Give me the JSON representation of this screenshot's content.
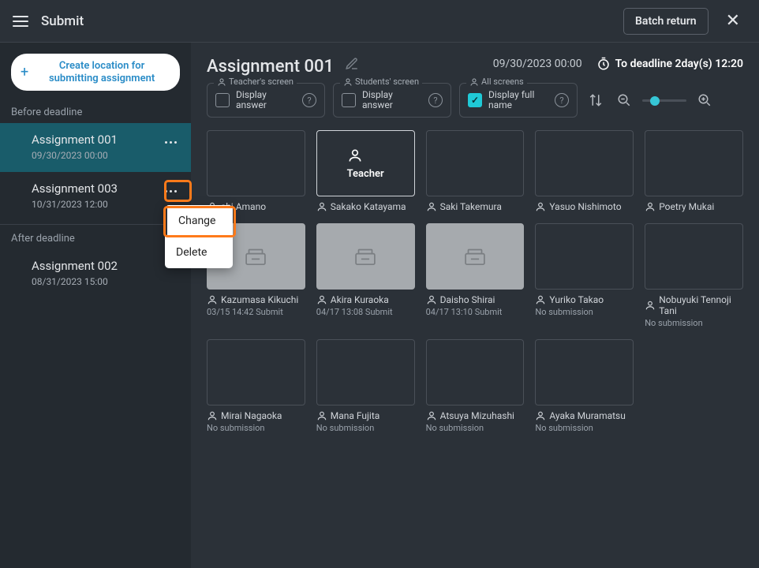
{
  "header": {
    "title": "Submit",
    "batch_return": "Batch return"
  },
  "sidebar": {
    "create_label": "Create location for submitting assignment",
    "section_before": "Before deadline",
    "section_after": "After deadline",
    "before": [
      {
        "name": "Assignment 001",
        "date": "09/30/2023 00:00"
      },
      {
        "name": "Assignment 003",
        "date": "10/31/2023 12:00"
      }
    ],
    "after": [
      {
        "name": "Assignment 002",
        "date": "08/31/2023 15:00"
      }
    ]
  },
  "context_menu": {
    "change": "Change",
    "delete": "Delete"
  },
  "main": {
    "title": "Assignment 001",
    "deadline_date": "09/30/2023 00:00",
    "deadline_countdown": "To deadline 2day(s) 12:20"
  },
  "controls": {
    "teacher_legend": "Teacher's screen",
    "students_legend": "Students' screen",
    "allscreens_legend": "All screens",
    "display_answer": "Display answer",
    "display_fullname": "Display full name"
  },
  "cards": [
    {
      "type": "teacher",
      "label": "Teacher"
    },
    {
      "name": "shi Amano"
    },
    {
      "name": "Sakako Katayama"
    },
    {
      "name": "Saki Takemura"
    },
    {
      "name": "Yasuo Nishimoto"
    },
    {
      "name": "Poetry Mukai"
    },
    {
      "name": "Kazumasa Kikuchi",
      "sub": "03/15 14:42 Submit",
      "submitted": true
    },
    {
      "name": "Akira Kuraoka",
      "sub": "04/17 13:08 Submit",
      "submitted": true
    },
    {
      "name": "Daisho Shirai",
      "sub": "04/17 13:10 Submit",
      "submitted": true
    },
    {
      "name": "Yuriko Takao",
      "sub": "No submission"
    },
    {
      "name": "Nobuyuki Tennoji Tani",
      "sub": "No submission"
    },
    {
      "name": "Mirai Nagaoka",
      "sub": "No submission"
    },
    {
      "name": "Mana Fujita",
      "sub": "No submission"
    },
    {
      "name": "Atsuya Mizuhashi",
      "sub": "No submission"
    },
    {
      "name": "Ayaka Muramatsu",
      "sub": "No submission"
    }
  ]
}
